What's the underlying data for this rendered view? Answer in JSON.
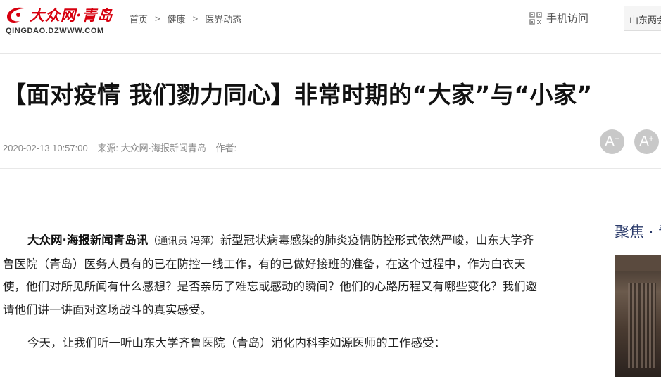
{
  "header": {
    "logo_text": "大众网·青岛",
    "logo_sub": "QINGDAO.DZWWW.COM",
    "breadcrumb": [
      "首页",
      "健康",
      "医界动态"
    ],
    "breadcrumb_sep": ">",
    "mobile_label": "手机访问",
    "topic_box": "山东两会"
  },
  "article": {
    "title": "【面对疫情 我们勠力同心】非常时期的“大家”与“小家”",
    "datetime": "2020-02-13 10:57:00",
    "source": "来源: 大众网·海报新闻青岛",
    "author": "作者:",
    "font_minus": "A",
    "font_plus": "A",
    "dateline": "大众网·海报新闻青岛讯",
    "reporter": "（通讯员 冯萍）",
    "para1_rest": "新型冠状病毒感染的肺炎疫情防控形式依然严峻，山东大学齐鲁医院（青岛）医务人员有的已在防控一线工作，有的已做好接班的准备，在这个过程中，作为白衣天使，他们对所见所闻有什么感想？是否亲历了难忘或感动的瞬间？他们的心路历程又有哪些变化？我们邀请他们讲一讲面对这场战斗的真实感受。",
    "para2": "今天，让我们听一听山东大学齐鲁医院（青岛）消化内科李如源医师的工作感受："
  },
  "sidebar": {
    "focus_title": "聚焦 · 青"
  },
  "colors": {
    "brand_red": "#d7000f",
    "focus_blue": "#2a3a6a"
  }
}
